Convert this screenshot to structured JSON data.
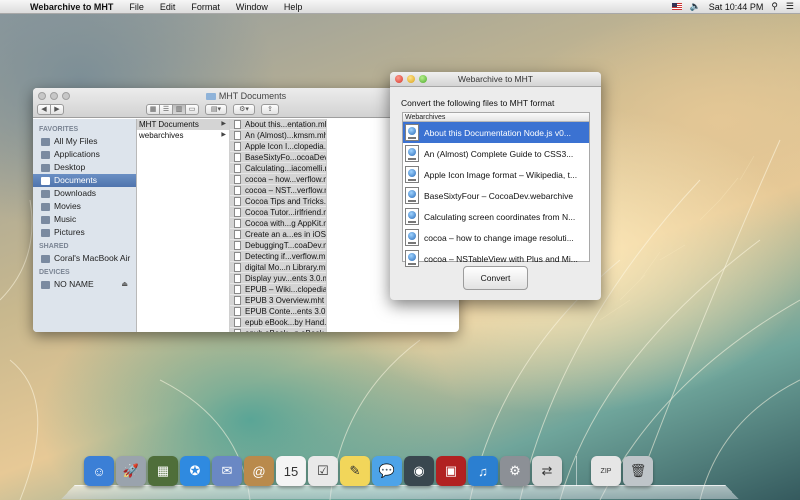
{
  "menubar": {
    "app_name": "Webarchive to MHT",
    "menus": [
      "File",
      "Edit",
      "Format",
      "Window",
      "Help"
    ],
    "clock": "Sat 10:44 PM"
  },
  "finder": {
    "title": "MHT Documents",
    "sidebar": {
      "favorites_heading": "FAVORITES",
      "favorites": [
        "All My Files",
        "Applications",
        "Desktop",
        "Documents",
        "Downloads",
        "Movies",
        "Music",
        "Pictures"
      ],
      "selected": "Documents",
      "shared_heading": "SHARED",
      "shared": [
        "Coral's MacBook Air"
      ],
      "devices_heading": "DEVICES",
      "devices": [
        "NO NAME"
      ]
    },
    "column1": [
      "MHT Documents",
      "webarchives"
    ],
    "files": [
      "About this...entation.mht",
      "An (Almost)...kmsm.mht",
      "Apple Icon I...clopedia.mht",
      "BaseSixtyFo...ocoaDev.mht",
      "Calculating...iacomelli.mht",
      "cocoa – how...verflow.mht",
      "cocoa – NST...verflow.mht",
      "Cocoa Tips and Tricks.mht",
      "Cocoa Tutor...irlfriend.mht",
      "Cocoa with...g AppKit.mht",
      "Create an a...es in iOS.mht",
      "DebuggingT...coaDev.mht",
      "Detecting if...verflow.mht",
      "digital    Mo...n Library.mht",
      "Display yuv...ents 3.0.mht",
      "EPUB – Wiki...clopedia.mht",
      "EPUB 3 Overview.mht",
      "EPUB Conte...ents 3.0.mht",
      "epub eBook...by Hand.mht",
      "epub eBook...n eBook.mht",
      "Epub Forma... – 2007.mht"
    ]
  },
  "dialog": {
    "title": "Webarchive to MHT",
    "prompt": "Convert the following files to MHT format",
    "list_header": "Webarchives",
    "items": [
      "About this Documentation Node.js v0...",
      "An (Almost) Complete Guide to CSS3...",
      "Apple Icon Image format – Wikipedia, t...",
      "BaseSixtyFour – CocoaDev.webarchive",
      "Calculating screen coordinates from N...",
      "cocoa – how to change image resoluti...",
      "cocoa – NSTableView with Plus and Mi..."
    ],
    "selected_index": 0,
    "convert_label": "Convert"
  },
  "dock": {
    "apps": [
      {
        "name": "finder-icon",
        "color": "#3b7fd6",
        "glyph": "☺"
      },
      {
        "name": "launchpad-icon",
        "color": "#9aa3ad",
        "glyph": "🚀"
      },
      {
        "name": "mission-control-icon",
        "color": "#4f6e3a",
        "glyph": "▦"
      },
      {
        "name": "safari-icon",
        "color": "#2f8ae0",
        "glyph": "✪"
      },
      {
        "name": "mail-icon",
        "color": "#6a88c4",
        "glyph": "✉"
      },
      {
        "name": "contacts-icon",
        "color": "#b98a4c",
        "glyph": "@"
      },
      {
        "name": "calendar-icon",
        "color": "#f4f4f4",
        "glyph": "15"
      },
      {
        "name": "reminders-icon",
        "color": "#e9e9e9",
        "glyph": "☑"
      },
      {
        "name": "notes-icon",
        "color": "#f2d65a",
        "glyph": "✎"
      },
      {
        "name": "messages-icon",
        "color": "#4da3e8",
        "glyph": "💬"
      },
      {
        "name": "facetime-icon",
        "color": "#39474f",
        "glyph": "◉"
      },
      {
        "name": "photo-booth-icon",
        "color": "#b12121",
        "glyph": "▣"
      },
      {
        "name": "itunes-icon",
        "color": "#2b7fd1",
        "glyph": "♫"
      },
      {
        "name": "system-preferences-icon",
        "color": "#8c9096",
        "glyph": "⚙"
      },
      {
        "name": "webarchive-to-mht-icon",
        "color": "#d9d9d9",
        "glyph": "⇄"
      }
    ],
    "right": [
      {
        "name": "archive-zip-icon",
        "color": "#e6e6e6",
        "glyph": "ZIP"
      },
      {
        "name": "trash-icon",
        "color": "#bfc5c9",
        "glyph": "🗑"
      }
    ]
  }
}
